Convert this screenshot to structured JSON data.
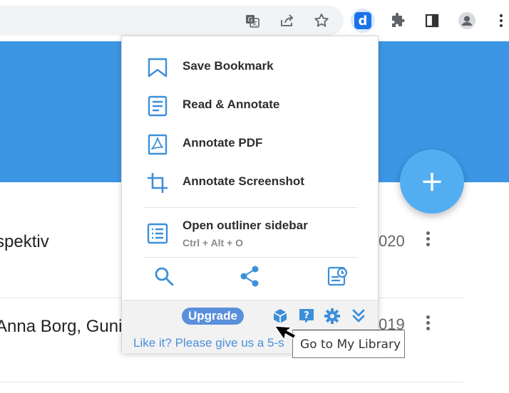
{
  "popup": {
    "menu": [
      {
        "label": "Save Bookmark",
        "icon": "bookmark-icon"
      },
      {
        "label": "Read & Annotate",
        "icon": "document-icon"
      },
      {
        "label": "Annotate PDF",
        "icon": "pdf-icon"
      },
      {
        "label": "Annotate Screenshot",
        "icon": "crop-icon"
      }
    ],
    "outliner": {
      "label": "Open outliner sidebar",
      "shortcut": "Ctrl + Alt + O",
      "icon": "outline-list-icon"
    },
    "tools": [
      "search-icon",
      "share-icon",
      "page-history-icon"
    ],
    "footer": {
      "upgrade_label": "Upgrade",
      "icons": [
        "library-cube-icon",
        "help-icon",
        "settings-icon",
        "expand-down-icon"
      ],
      "rate_text": "Like it? Please give us a 5-s"
    }
  },
  "tooltip": {
    "text": "Go to My Library"
  },
  "background": {
    "rows": [
      {
        "title": "spektiv",
        "year": "020"
      },
      {
        "title": "Anna Borg, Gunil",
        "year": "019"
      }
    ],
    "fab_label": "+"
  },
  "colors": {
    "accent": "#3d96e3",
    "fab": "#52aef0",
    "brand": "#1a73e8",
    "icon_blue": "#3d8fd9"
  }
}
